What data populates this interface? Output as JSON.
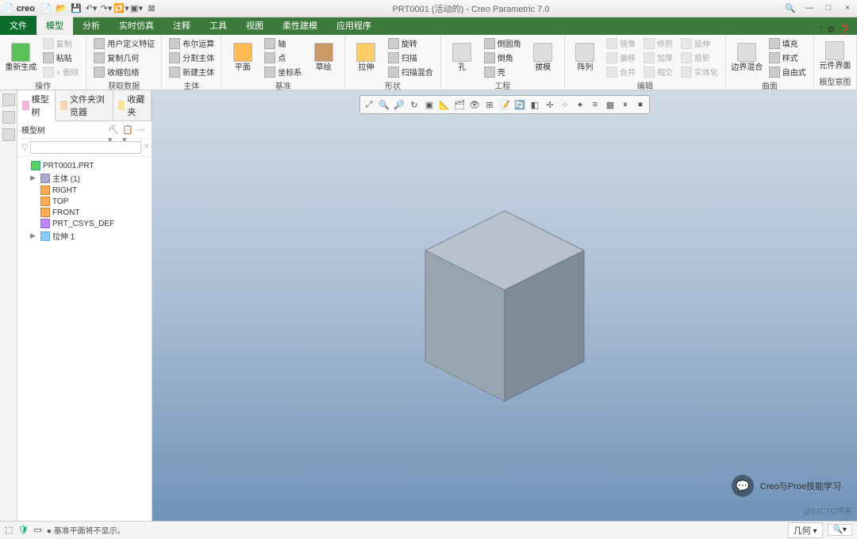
{
  "app": {
    "brand": "creo",
    "title": "PRT0001 (活动的) - Creo Parametric 7.0"
  },
  "qat": [
    "new",
    "open",
    "save",
    "undo",
    "redo",
    "regen",
    "close",
    "windows"
  ],
  "wincontrols": {
    "min": "—",
    "max": "□",
    "close": "×"
  },
  "tabs": {
    "file": "文件",
    "items": [
      "模型",
      "分析",
      "实时仿真",
      "注释",
      "工具",
      "视图",
      "柔性建模",
      "应用程序"
    ],
    "active": 0
  },
  "ribbon": {
    "g1": {
      "label": "操作",
      "big": "重新生成",
      "small": [
        "复制",
        "粘贴",
        "× 删除"
      ]
    },
    "g2": {
      "label": "获取数据",
      "small": [
        "用户定义特征",
        "复制几何",
        "收缩包络"
      ]
    },
    "g3": {
      "label": "主体",
      "small": [
        "布尔运算",
        "分割主体",
        "新建主体"
      ]
    },
    "g4": {
      "label": "基准",
      "big": "平面",
      "small": [
        "轴",
        "点",
        "坐标系"
      ],
      "big2": "草绘"
    },
    "g5": {
      "label": "形状",
      "big": "拉伸",
      "small": [
        "旋转",
        "扫描",
        "扫描混合"
      ]
    },
    "g6": {
      "label": "工程",
      "big": "孔",
      "small": [
        "倒圆角",
        "倒角",
        "壳"
      ],
      "big2": "拔模"
    },
    "g7": {
      "label": "编辑",
      "big": "阵列",
      "small": [
        "镜像",
        "修剪",
        "延伸",
        "投影",
        "偏移",
        "加厚",
        "合并",
        "相交",
        "实体化"
      ]
    },
    "g8": {
      "label": "曲面",
      "big": "边界混合",
      "small": [
        "填充",
        "样式",
        "自由式"
      ]
    },
    "g9": {
      "label": "模型意图",
      "big": "元件界面"
    }
  },
  "paneltabs": [
    "模型树",
    "文件夹浏览器",
    "收藏夹"
  ],
  "panel": {
    "title": "模型树",
    "filter_ph": ""
  },
  "tree": [
    {
      "icon": "part",
      "label": "PRT0001.PRT",
      "exp": ""
    },
    {
      "icon": "body",
      "label": "主体 (1)",
      "exp": "▶",
      "indent": 1
    },
    {
      "icon": "plane",
      "label": "RIGHT",
      "exp": "",
      "indent": 1
    },
    {
      "icon": "plane",
      "label": "TOP",
      "exp": "",
      "indent": 1
    },
    {
      "icon": "plane",
      "label": "FRONT",
      "exp": "",
      "indent": 1
    },
    {
      "icon": "csys",
      "label": "PRT_CSYS_DEF",
      "exp": "",
      "indent": 1
    },
    {
      "icon": "feat",
      "label": "拉伸 1",
      "exp": "▶",
      "indent": 1
    }
  ],
  "status": {
    "msg": "● 基准平面将不显示。",
    "right": "几何",
    "find": "🔍"
  },
  "watermark": "Creo与Proe技能学习",
  "credit": "@51CTO博客"
}
